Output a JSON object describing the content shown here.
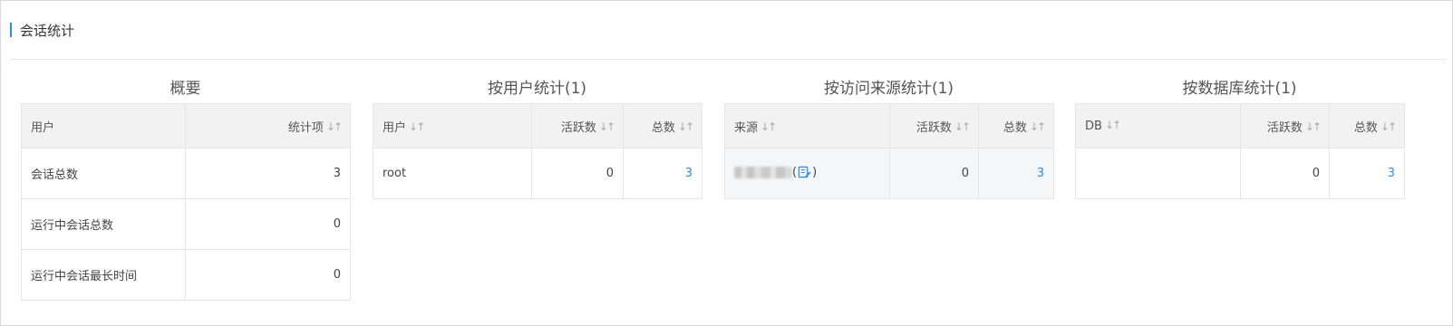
{
  "section": {
    "title": "会话统计"
  },
  "sort_glyph": "↓↑",
  "summary": {
    "title": "概要",
    "headers": {
      "user": "用户",
      "stat": "统计项"
    },
    "rows": [
      {
        "label": "会话总数",
        "value": "3"
      },
      {
        "label": "运行中会话总数",
        "value": "0"
      },
      {
        "label": "运行中会话最长时间",
        "value": "0"
      }
    ]
  },
  "by_user": {
    "title": "按用户统计(1)",
    "headers": {
      "user": "用户",
      "active": "活跃数",
      "total": "总数"
    },
    "rows": [
      {
        "user": "root",
        "active": "0",
        "total": "3"
      }
    ]
  },
  "by_source": {
    "title": "按访问来源统计(1)",
    "headers": {
      "source": "来源",
      "active": "活跃数",
      "total": "总数"
    },
    "rows": [
      {
        "paren_open": "(",
        "paren_close": ")",
        "active": "0",
        "total": "3"
      }
    ]
  },
  "by_db": {
    "title": "按数据库统计(1)",
    "headers": {
      "db": "DB",
      "active": "活跃数",
      "total": "总数"
    },
    "rows": [
      {
        "db": "",
        "active": "0",
        "total": "3"
      }
    ]
  },
  "colors": {
    "accent": "#2d8cf0",
    "header_bg": "#f2f2f2",
    "border": "#e6e6e6"
  }
}
